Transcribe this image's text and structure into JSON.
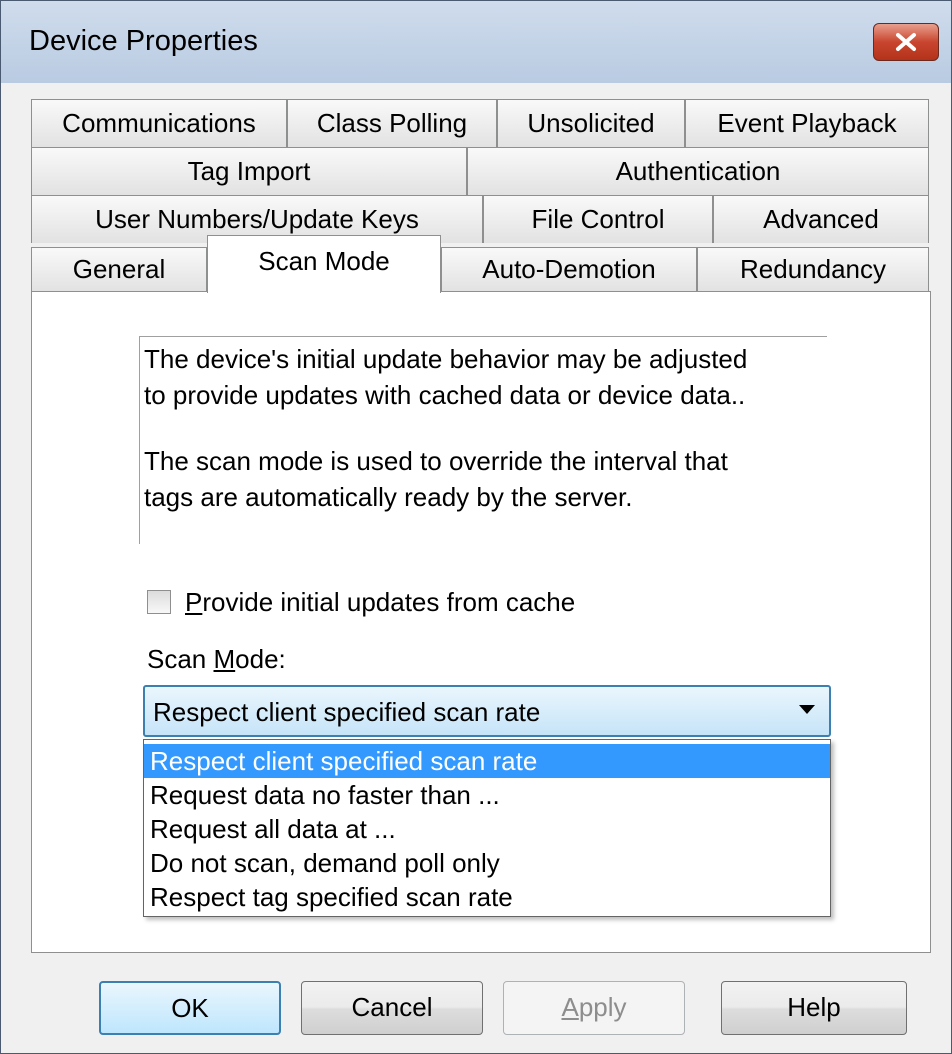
{
  "window": {
    "title": "Device Properties",
    "close_icon": "close-x-icon"
  },
  "tabs": {
    "row1": [
      "Communications",
      "Class Polling",
      "Unsolicited",
      "Event Playback"
    ],
    "row2": [
      "Tag Import",
      "Authentication"
    ],
    "row3": [
      "User Numbers/Update Keys",
      "File Control",
      "Advanced"
    ],
    "row4": [
      "General",
      "Scan Mode",
      "Auto-Demotion",
      "Redundancy"
    ],
    "active": "Scan Mode"
  },
  "panel": {
    "description_1_line1": "The device's initial update behavior may be adjusted",
    "description_1_line2": "to provide updates with cached data or device data..",
    "description_2_line1": "The scan mode is used to override the interval that",
    "description_2_line2": "tags are automatically ready by the server.",
    "checkbox": {
      "label_first": "P",
      "label_rest": "rovide initial updates from cache",
      "checked": false
    },
    "scan_mode_label": {
      "pre": "Scan ",
      "u": "M",
      "post": "ode:"
    },
    "combo_value": "Respect client specified scan rate",
    "options": [
      "Respect client specified scan rate",
      "Request data no faster than ...",
      "Request all data at ...",
      "Do not scan, demand poll only",
      "Respect tag specified scan rate"
    ],
    "selected_option": "Respect client specified scan rate"
  },
  "buttons": {
    "ok": "OK",
    "cancel": "Cancel",
    "apply_first": "A",
    "apply_rest": "pply",
    "help": "Help"
  },
  "colors": {
    "selection": "#3399ff",
    "focus_border": "#3c7fb1",
    "close_button": "#c9452f"
  }
}
